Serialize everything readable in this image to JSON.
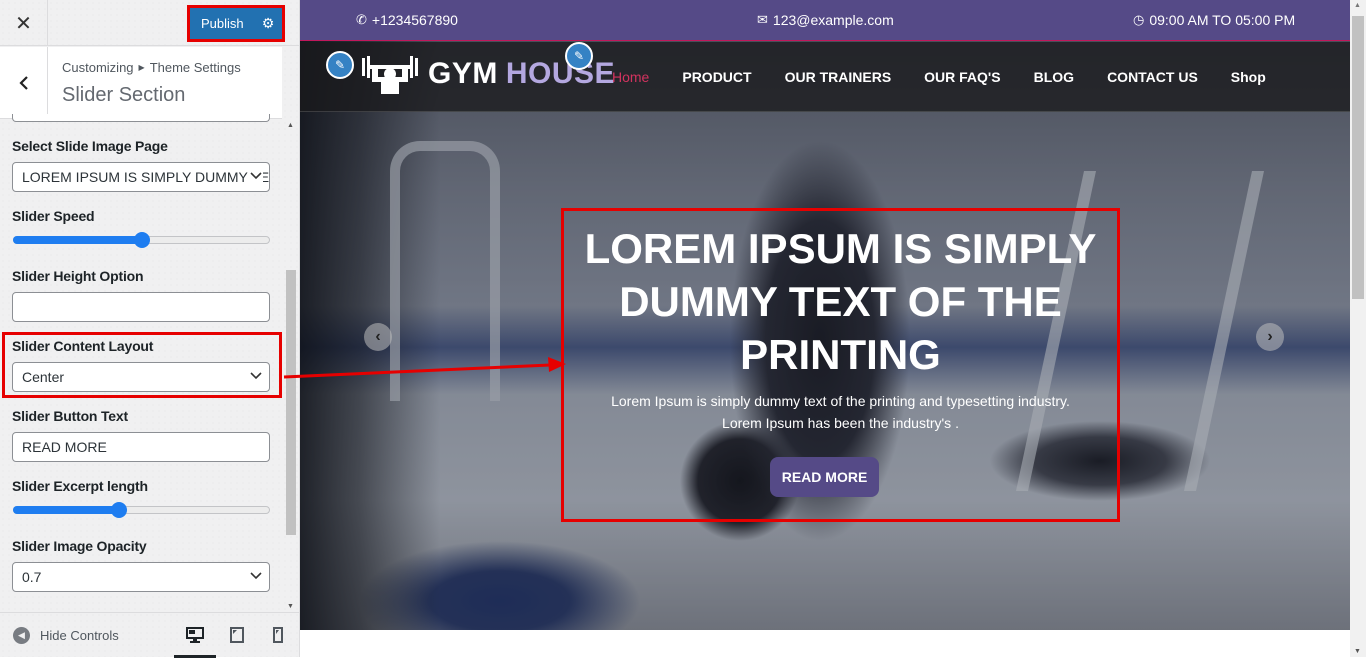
{
  "customizer": {
    "close_label": "✕",
    "publish_label": "Publish",
    "breadcrumb": [
      "Customizing",
      "Theme Settings"
    ],
    "section_title": "Slider Section",
    "controls": {
      "slide_image_page": {
        "label": "Select Slide Image Page",
        "value": "LOREM IPSUM IS SIMPLY DUMMY TEXT"
      },
      "slider_speed": {
        "label": "Slider Speed",
        "value_fraction": 0.5
      },
      "slider_height": {
        "label": "Slider Height Option",
        "value": ""
      },
      "content_layout": {
        "label": "Slider Content Layout",
        "value": "Center"
      },
      "button_text": {
        "label": "Slider Button Text",
        "value": "READ MORE"
      },
      "excerpt_length": {
        "label": "Slider Excerpt length",
        "value_fraction": 0.41
      },
      "image_opacity": {
        "label": "Slider Image Opacity",
        "value": "0.7"
      }
    },
    "footer": {
      "hide_controls_label": "Hide Controls",
      "devices": [
        "desktop",
        "tablet",
        "mobile"
      ],
      "active_device": "desktop"
    }
  },
  "site": {
    "topbar": {
      "phone": "+1234567890",
      "email": "123@example.com",
      "hours": "09:00 AM TO 05:00 PM"
    },
    "logo": {
      "word1": "GYM",
      "word2": "HOUSE"
    },
    "nav": [
      "Home",
      "PRODUCT",
      "OUR TRAINERS",
      "OUR FAQ'S",
      "BLOG",
      "CONTACT US",
      "Shop"
    ],
    "active_nav": "Home",
    "slide": {
      "title": "LOREM IPSUM IS SIMPLY DUMMY TEXT OF THE PRINTING",
      "text_line1": "Lorem Ipsum is simply dummy text of the printing and typesetting industry.",
      "text_line2": "Lorem Ipsum has been the industry's .",
      "button": "READ MORE"
    }
  },
  "colors": {
    "publish": "#2271b1",
    "topbar": "#554a87",
    "accent_nav": "#d2335f",
    "slider_blue": "#1e7df0",
    "highlight_red": "#e60000",
    "logo_house": "#b4a8e0"
  }
}
